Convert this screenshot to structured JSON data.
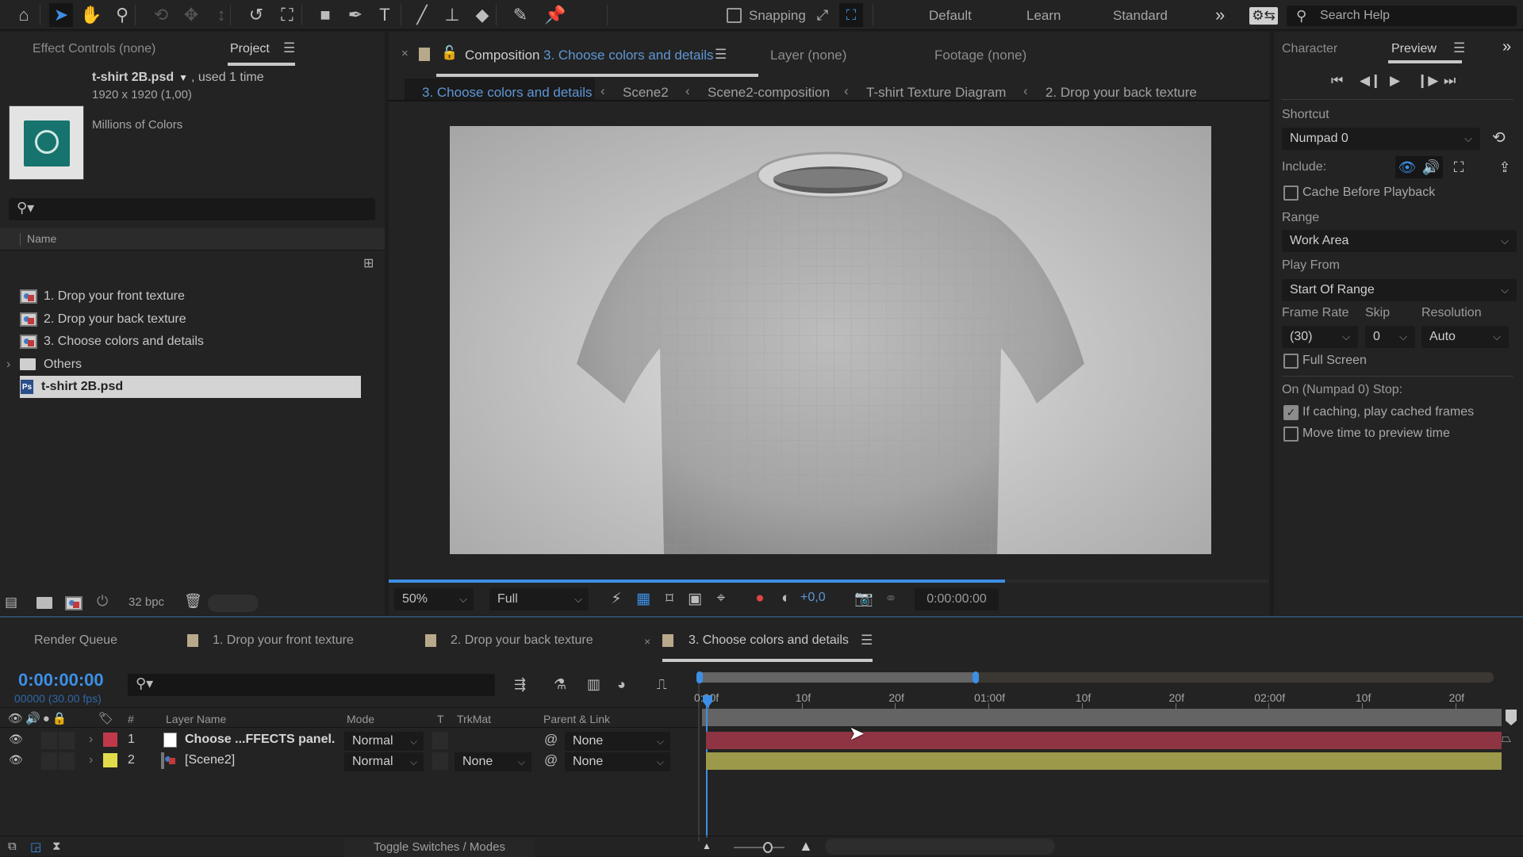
{
  "toolbar": {
    "tools": [
      {
        "name": "home-icon",
        "glyph": "⌂"
      },
      {
        "name": "selection-tool-icon",
        "glyph": "➤",
        "active": true
      },
      {
        "name": "hand-tool-icon",
        "glyph": "✋"
      },
      {
        "name": "zoom-tool-icon",
        "glyph": "⚲"
      },
      {
        "name": "rotate-camera-tool-icon",
        "glyph": "⟲",
        "dim": true
      },
      {
        "name": "pan-camera-tool-icon",
        "glyph": "✥",
        "dim": true
      },
      {
        "name": "dolly-camera-tool-icon",
        "glyph": "↕",
        "dim": true
      },
      {
        "name": "rotation-tool-icon",
        "glyph": "↺"
      },
      {
        "name": "pan-behind-tool-icon",
        "glyph": "⛶"
      },
      {
        "name": "rectangle-tool-icon",
        "glyph": "■"
      },
      {
        "name": "pen-tool-icon",
        "glyph": "✒"
      },
      {
        "name": "type-tool-icon",
        "glyph": "T"
      },
      {
        "name": "brush-tool-icon",
        "glyph": "╱"
      },
      {
        "name": "clone-stamp-tool-icon",
        "glyph": "⊥"
      },
      {
        "name": "eraser-tool-icon",
        "glyph": "◆"
      },
      {
        "name": "roto-brush-tool-icon",
        "glyph": "✎"
      },
      {
        "name": "puppet-pin-tool-icon",
        "glyph": "📌"
      }
    ],
    "snapping_label": "Snapping",
    "snapping_checked": false,
    "workspaces": [
      "Default",
      "Learn",
      "Standard"
    ],
    "more_label": "»",
    "search_help_placeholder": "Search Help"
  },
  "project_panel": {
    "tabs": [
      {
        "label": "Effect Controls",
        "suffix": "(none)",
        "active": false
      },
      {
        "label": "Project",
        "active": true
      }
    ],
    "selected_item": {
      "name": "t-shirt 2B.psd",
      "usage": ", used 1 time",
      "dimensions": "1920 x 1920 (1,00)",
      "color_depth": "Millions of Colors"
    },
    "search_placeholder": "",
    "column_header": "Name",
    "items": [
      {
        "label": "1. Drop your front texture",
        "type": "composition"
      },
      {
        "label": "2. Drop your back texture",
        "type": "composition"
      },
      {
        "label": "3. Choose colors and details",
        "type": "composition"
      },
      {
        "label": "Others",
        "type": "folder",
        "expandable": true
      },
      {
        "label": "t-shirt 2B.psd",
        "type": "psd",
        "selected": true
      }
    ],
    "footer": {
      "bpc_label": "32 bpc"
    }
  },
  "composition_panel": {
    "tab_prefix": "Composition",
    "tab_name": "3. Choose colors and details",
    "other_tabs": [
      {
        "label": "Layer",
        "suffix": "(none)"
      },
      {
        "label": "Footage",
        "suffix": "(none)"
      }
    ],
    "breadcrumbs": [
      "3. Choose colors and details",
      "Scene2",
      "Scene2-composition",
      "T-shirt Texture Diagram",
      "2. Drop your back texture"
    ],
    "render_progress": 0.7,
    "magnification": "50%",
    "resolution": "Full",
    "exposure": "+0,0",
    "current_time": "0:00:00:00"
  },
  "preview_panel": {
    "tabs": [
      {
        "label": "Character",
        "active": false
      },
      {
        "label": "Preview",
        "active": true
      }
    ],
    "shortcut_label": "Shortcut",
    "shortcut_value": "Numpad 0",
    "include_label": "Include:",
    "cache_before_playback": {
      "label": "Cache Before Playback",
      "checked": false
    },
    "range_label": "Range",
    "range_value": "Work Area",
    "play_from_label": "Play From",
    "play_from_value": "Start Of Range",
    "frame_rate_label": "Frame Rate",
    "frame_rate_value": "(30)",
    "skip_label": "Skip",
    "skip_value": "0",
    "resolution_label": "Resolution",
    "resolution_value": "Auto",
    "full_screen": {
      "label": "Full Screen",
      "checked": false
    },
    "stop_label": "On (Numpad 0) Stop:",
    "if_caching": {
      "label": "If caching, play cached frames",
      "checked": true
    },
    "move_time": {
      "label": "Move time to preview time",
      "checked": false
    }
  },
  "timeline": {
    "tabs": [
      {
        "label": "Render Queue",
        "swatch": false
      },
      {
        "label": "1. Drop your front texture",
        "swatch": true
      },
      {
        "label": "2. Drop your back texture",
        "swatch": true
      },
      {
        "label": "3. Choose colors and details",
        "swatch": true,
        "active": true,
        "closable": true
      }
    ],
    "current_time": "0:00:00:00",
    "frame_info": "00000 (30.00 fps)",
    "search_placeholder": "",
    "columns": {
      "number": "#",
      "layer_name": "Layer Name",
      "mode": "Mode",
      "t": "T",
      "trkmat": "TrkMat",
      "parent": "Parent & Link"
    },
    "layers": [
      {
        "index": "1",
        "name": "Choose ...FFECTS panel.",
        "label_color": "#c0394a",
        "mode": "Normal",
        "trkmat": "",
        "parent": "None",
        "bar_color": "#8e3442",
        "type": "solid"
      },
      {
        "index": "2",
        "name": "[Scene2]",
        "label_color": "#e2dc4c",
        "mode": "Normal",
        "trkmat": "None",
        "parent": "None",
        "bar_color": "#9c9a4a",
        "type": "composition"
      }
    ],
    "ruler_labels": [
      "0:00f",
      "10f",
      "20f",
      "01:00f",
      "10f",
      "20f",
      "02:00f",
      "10f",
      "20f"
    ],
    "work_area_end_fraction": 0.35,
    "toggle_label": "Toggle Switches / Modes"
  },
  "colors": {
    "accent": "#3d8fe6",
    "link_blue": "#5f96d6",
    "panel_bg": "#232323",
    "tab_swatch": "#b8a98c"
  }
}
